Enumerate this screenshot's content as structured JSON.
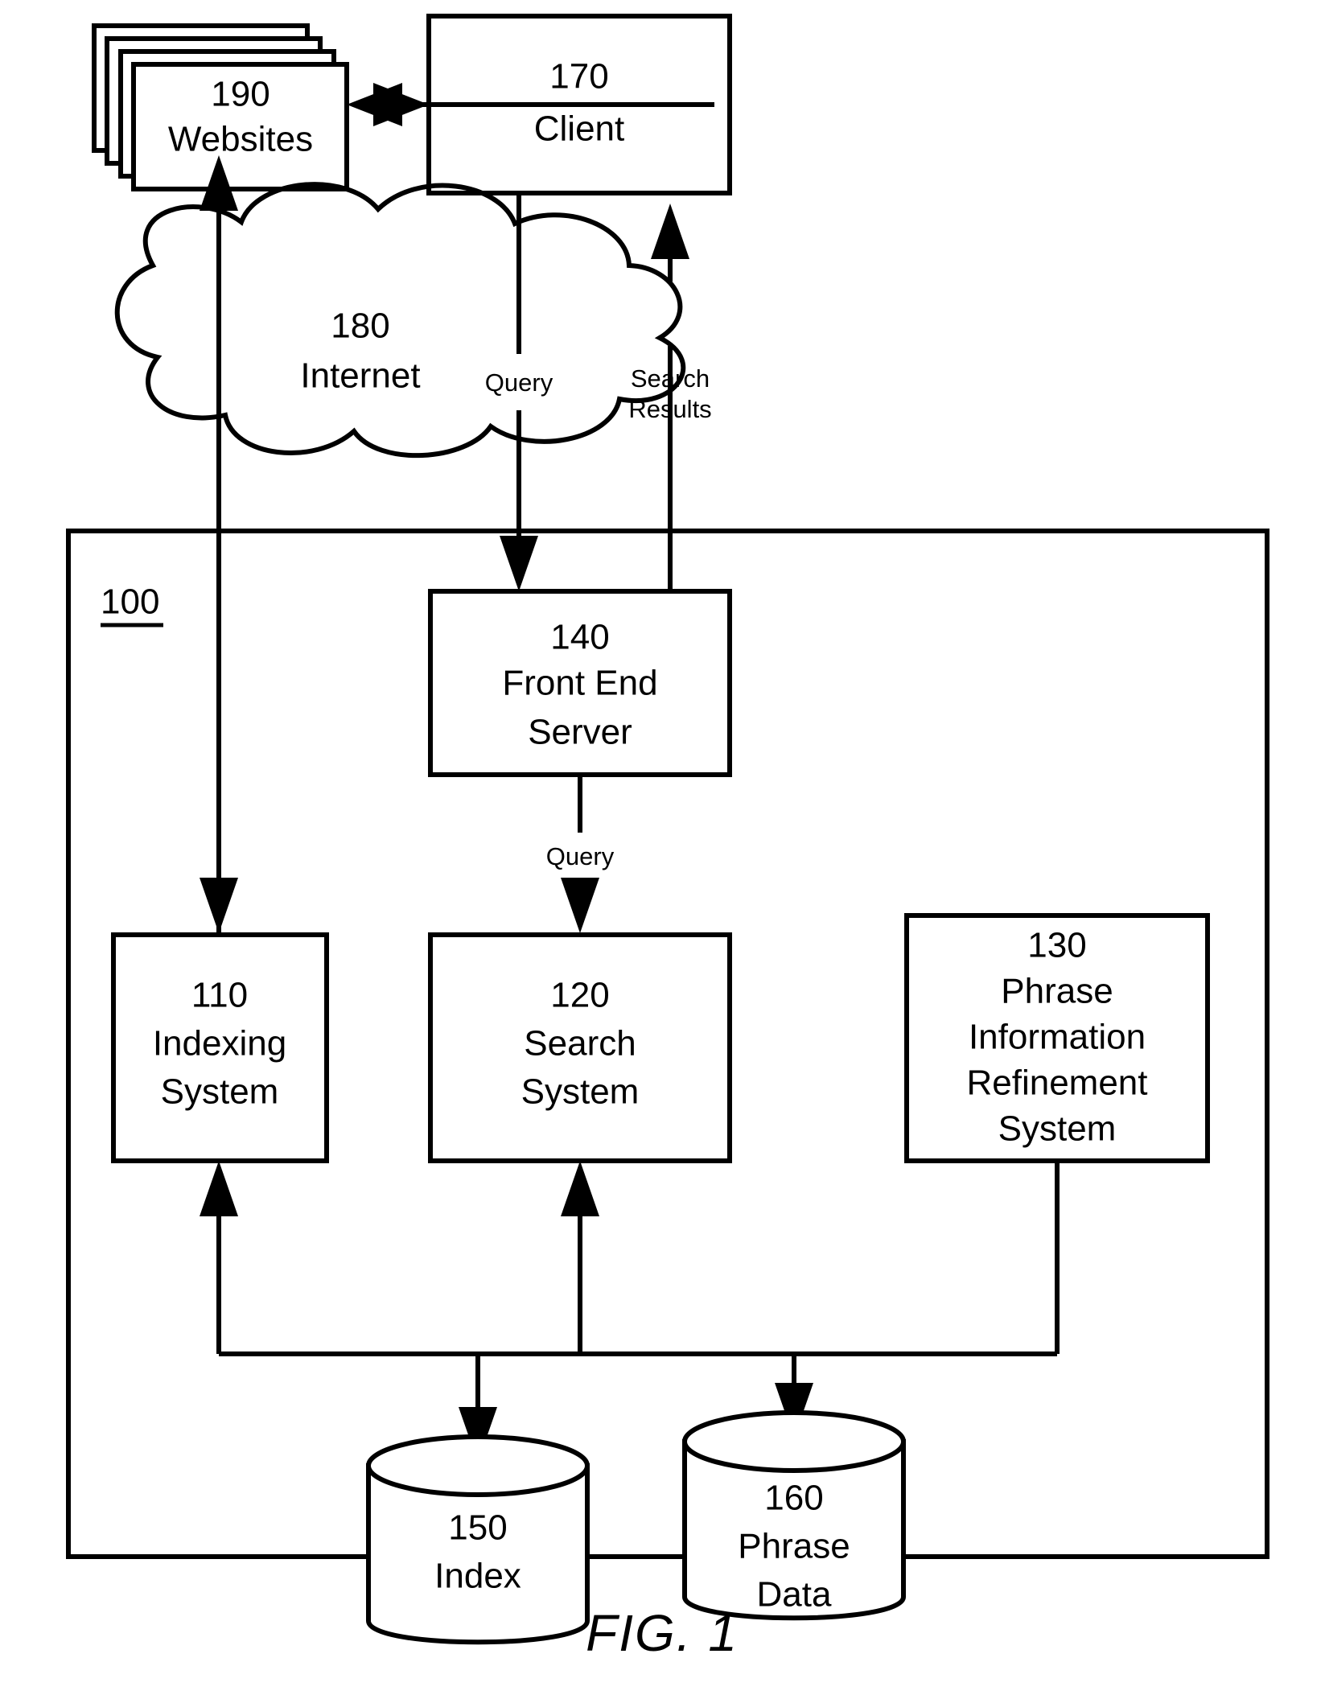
{
  "figure": {
    "caption": "FIG. 1",
    "system_ref": "100"
  },
  "nodes": {
    "websites": {
      "ref": "190",
      "label": "Websites"
    },
    "client": {
      "ref": "170",
      "label": "Client"
    },
    "internet": {
      "ref": "180",
      "label": "Internet"
    },
    "front_end_server": {
      "ref": "140",
      "line1": "Front End",
      "line2": "Server"
    },
    "indexing_system": {
      "ref": "110",
      "line1": "Indexing",
      "line2": "System"
    },
    "search_system": {
      "ref": "120",
      "line1": "Search",
      "line2": "System"
    },
    "phrase_refinement_system": {
      "ref": "130",
      "line1": "Phrase",
      "line2": "Information",
      "line3": "Refinement",
      "line4": "System"
    },
    "index_store": {
      "ref": "150",
      "label": "Index"
    },
    "phrase_data_store": {
      "ref": "160",
      "line1": "Phrase",
      "line2": "Data"
    }
  },
  "edge_labels": {
    "query_internet": "Query",
    "search_results_line1": "Search",
    "search_results_line2": "Results",
    "query_frontend": "Query"
  },
  "colors": {
    "stroke": "#000000",
    "background": "#ffffff"
  }
}
